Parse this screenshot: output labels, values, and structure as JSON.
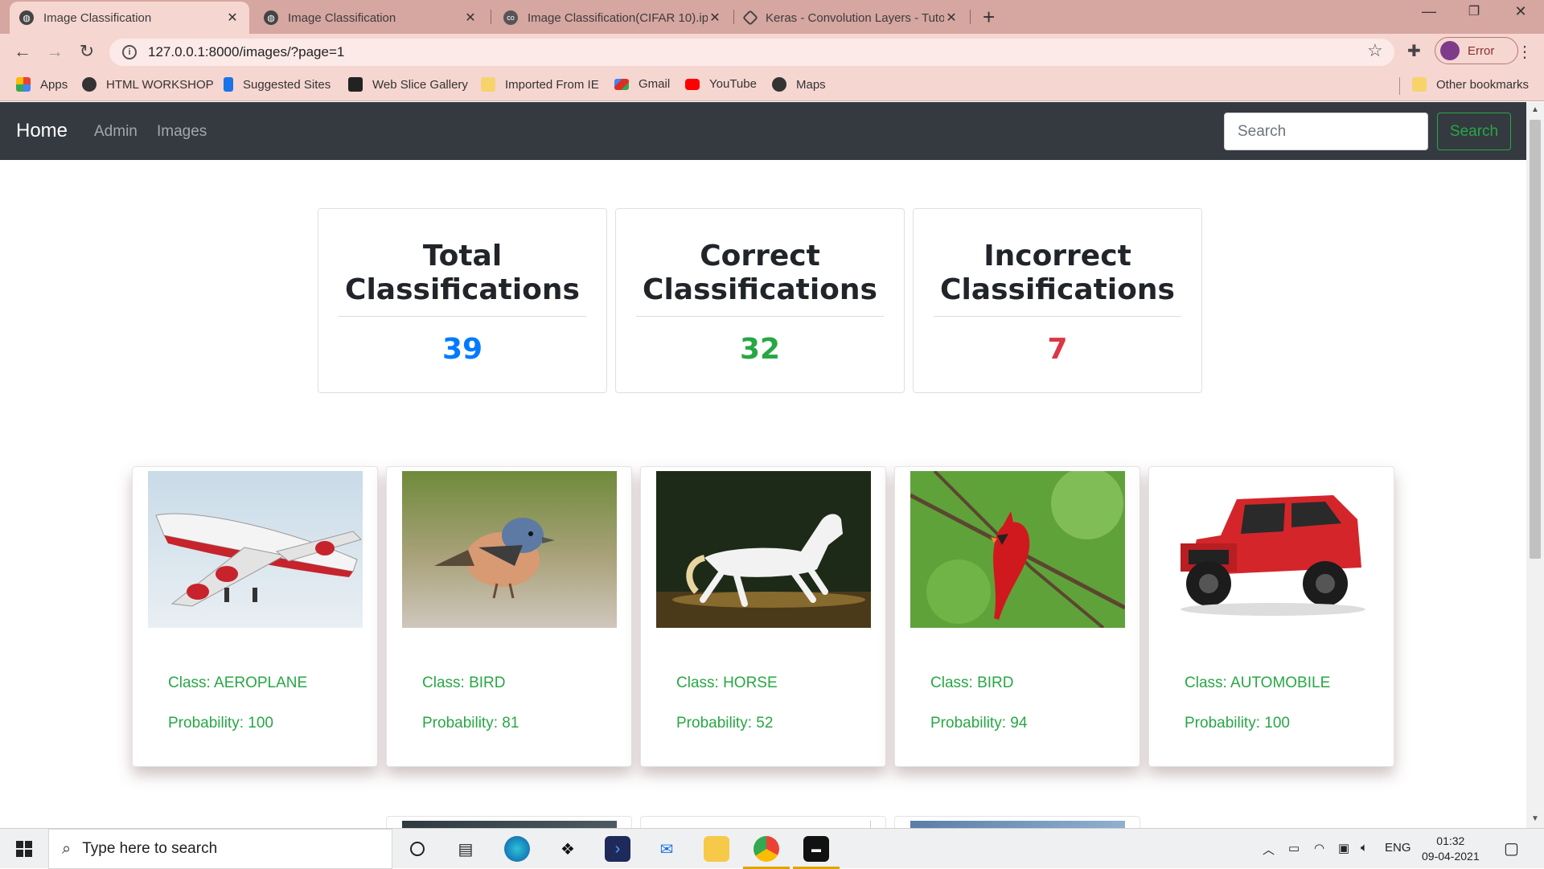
{
  "browser": {
    "tabs": [
      {
        "title": "Image Classification",
        "icon": "globe-icon",
        "active": true
      },
      {
        "title": "Image Classification",
        "icon": "globe-icon",
        "active": false
      },
      {
        "title": "Image Classification(CIFAR 10).ip",
        "icon": "colab-icon",
        "active": false
      },
      {
        "title": "Keras - Convolution Layers - Tuto",
        "icon": "tutorialspoint-icon",
        "active": false
      }
    ],
    "url": "127.0.0.1:8000/images/?page=1",
    "profile_label": "Error",
    "bookmarks": [
      {
        "label": "Apps",
        "icon": "apps-grid-icon",
        "color": "#e94235"
      },
      {
        "label": "HTML WORKSHOP",
        "icon": "globe-icon",
        "color": "#333333"
      },
      {
        "label": "Suggested Sites",
        "icon": "bing-icon",
        "color": "#1a73e8"
      },
      {
        "label": "Web Slice Gallery",
        "icon": "web-slice-icon",
        "color": "#222222"
      },
      {
        "label": "Imported From IE",
        "icon": "folder-icon",
        "color": "#f7d36b"
      },
      {
        "label": "Gmail",
        "icon": "gmail-icon",
        "color": "#d93025"
      },
      {
        "label": "YouTube",
        "icon": "youtube-icon",
        "color": "#ff0000"
      },
      {
        "label": "Maps",
        "icon": "globe-icon",
        "color": "#333333"
      }
    ],
    "other_bookmarks": "Other bookmarks"
  },
  "navbar": {
    "brand": "Home",
    "links": [
      "Admin",
      "Images"
    ],
    "search_placeholder": "Search",
    "search_button": "Search"
  },
  "stats": [
    {
      "title": "Total Classifications",
      "value": "39",
      "color": "#007bff"
    },
    {
      "title": "Correct Classifications",
      "value": "32",
      "color": "#28a745"
    },
    {
      "title": "Incorrect Classifications",
      "value": "7",
      "color": "#dc3545"
    }
  ],
  "cards": [
    {
      "class_text": "Class: AEROPLANE",
      "prob_text": "Probability: 100",
      "image": "aeroplane-photo"
    },
    {
      "class_text": "Class: BIRD",
      "prob_text": "Probability: 81",
      "image": "bird-photo"
    },
    {
      "class_text": "Class: HORSE",
      "prob_text": "Probability: 52",
      "image": "horse-photo"
    },
    {
      "class_text": "Class: BIRD",
      "prob_text": "Probability: 94",
      "image": "cardinal-photo"
    },
    {
      "class_text": "Class: AUTOMOBILE",
      "prob_text": "Probability: 100",
      "image": "jeep-photo"
    }
  ],
  "taskbar": {
    "search_placeholder": "Type here to search",
    "language": "ENG",
    "time": "01:32",
    "date": "09-04-2021"
  }
}
